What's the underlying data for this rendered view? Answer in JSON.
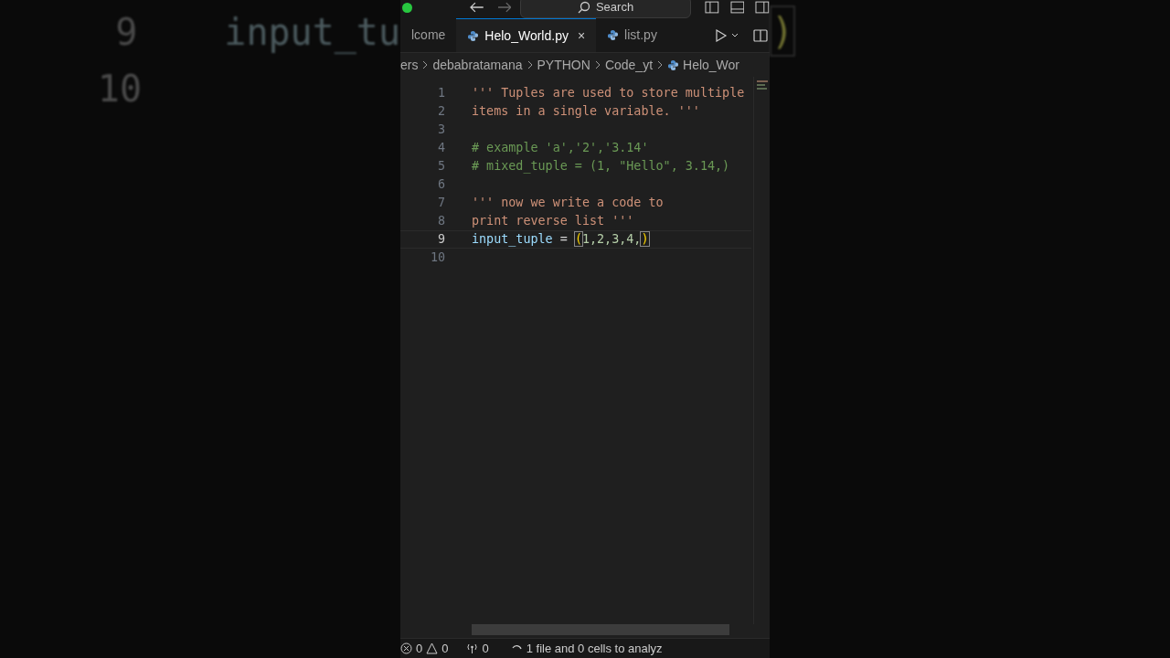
{
  "backdrop": {
    "left_lines": [
      {
        "number": "9",
        "code": "input_tu"
      },
      {
        "number": "10"
      }
    ],
    "right_code": ")"
  },
  "title_bar": {
    "search": "Search"
  },
  "tabs": [
    {
      "label": "lcome",
      "python": false,
      "selected": false,
      "closable": false
    },
    {
      "label": "Helo_World.py",
      "python": true,
      "selected": true,
      "closable": true,
      "close": "×"
    },
    {
      "label": "list.py",
      "python": true,
      "selected": false,
      "closable": false
    }
  ],
  "breadcrumb": [
    {
      "label": "ers",
      "python": false
    },
    {
      "label": "debabratamana",
      "python": false
    },
    {
      "label": "PYTHON",
      "python": false
    },
    {
      "label": "Code_yt",
      "python": false
    },
    {
      "label": "Helo_Wor",
      "python": true
    }
  ],
  "editor": {
    "lines": [
      {
        "number": "1",
        "current": false,
        "tokens": [
          {
            "kind": "string",
            "text": "''' Tuples are used to store multiple"
          }
        ]
      },
      {
        "number": "2",
        "current": false,
        "tokens": [
          {
            "kind": "string",
            "text": "items in a single variable. '''"
          }
        ]
      },
      {
        "number": "3",
        "current": false
      },
      {
        "number": "4",
        "current": false,
        "tokens": [
          {
            "kind": "comment",
            "text": "# example 'a','2','3.14'"
          }
        ]
      },
      {
        "number": "5",
        "current": false,
        "tokens": [
          {
            "kind": "comment",
            "text": "# mixed_tuple = (1, \"Hello\", 3.14,)"
          }
        ]
      },
      {
        "number": "6",
        "current": false
      },
      {
        "number": "7",
        "current": false,
        "tokens": [
          {
            "kind": "string",
            "text": "''' now we write a code to"
          }
        ]
      },
      {
        "number": "8",
        "current": false,
        "tokens": [
          {
            "kind": "string",
            "text": "print reverse list '''"
          }
        ]
      },
      {
        "number": "9",
        "current": true,
        "tokens": [
          {
            "kind": "variable",
            "text": "input_tuple"
          },
          {
            "kind": "operator",
            "text": " = "
          },
          {
            "kind": "bracket",
            "text": "("
          },
          {
            "kind": "number",
            "text": "1,2,3,4,"
          },
          {
            "kind": "bracket",
            "text": ")"
          }
        ]
      },
      {
        "number": "10",
        "current": false
      }
    ]
  },
  "status_bar": {
    "errors": "0",
    "warnings": "0",
    "ports": "0",
    "analysis": "1 file and 0 cells to analyz"
  }
}
